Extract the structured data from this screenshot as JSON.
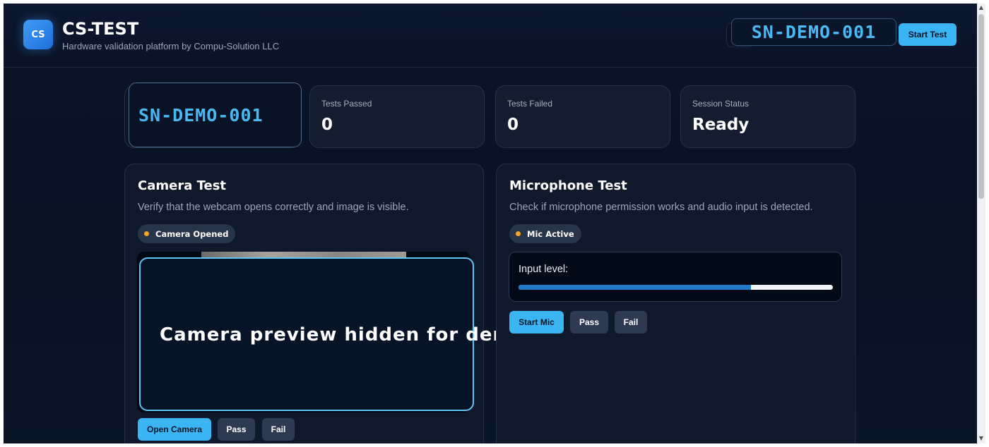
{
  "header": {
    "logo_text": "CS",
    "title": "CS-TEST",
    "subtitle": "Hardware validation platform by Compu-Solution LLC",
    "serial": "SN-DEMO-001",
    "start_test_label": "Start Test"
  },
  "stats": {
    "serial": "SN-DEMO-001",
    "cards": [
      {
        "label": "Tests Passed",
        "value": "0"
      },
      {
        "label": "Tests Failed",
        "value": "0"
      },
      {
        "label": "Session Status",
        "value": "Ready"
      }
    ]
  },
  "camera": {
    "title": "Camera Test",
    "description": "Verify that the webcam opens correctly and image is visible.",
    "status_badge": "Camera Opened",
    "status_color": "#f5a623",
    "preview_text": "Camera preview hidden for demo",
    "open_label": "Open Camera",
    "pass_label": "Pass",
    "fail_label": "Fail"
  },
  "microphone": {
    "title": "Microphone Test",
    "description": "Check if microphone permission works and audio input is detected.",
    "status_badge": "Mic Active",
    "status_color": "#f5a623",
    "level_label": "Input level:",
    "input_level_percent": 74,
    "start_label": "Start Mic",
    "pass_label": "Pass",
    "fail_label": "Fail"
  },
  "colors": {
    "accent": "#3ab4f2",
    "serial_text": "#4ab8f3",
    "background": "#0b1427"
  }
}
